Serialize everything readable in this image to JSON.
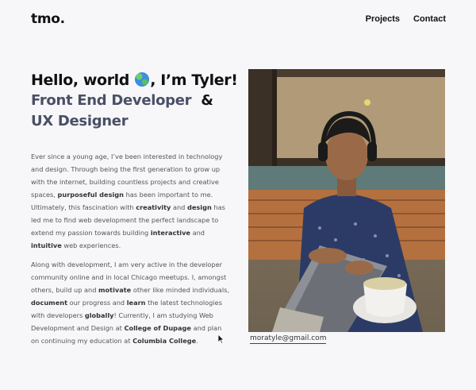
{
  "header": {
    "logo": "tmo.",
    "nav": [
      "Projects",
      "Contact"
    ]
  },
  "hero": {
    "greeting_before": "Hello, world",
    "greeting_after": ", I’m Tyler!",
    "role_line1": "Front End Developer",
    "role_amp": "&",
    "role_line2": "UX Designer"
  },
  "about": {
    "p1": [
      {
        "t": "Ever since a young age, I’ve been interested in technology and design. Through being the first generation to grow up with the internet, building countless projects and creative spaces, "
      },
      {
        "t": "purposeful design",
        "b": true
      },
      {
        "t": " has been important to me. Ultimately, this fascination with "
      },
      {
        "t": "creativity",
        "b": true
      },
      {
        "t": " and "
      },
      {
        "t": "design",
        "b": true
      },
      {
        "t": " has led me to find web development the perfect landscape to extend my passion towards building "
      },
      {
        "t": "interactive",
        "b": true
      },
      {
        "t": " and "
      },
      {
        "t": "intuitive",
        "b": true
      },
      {
        "t": " web experiences."
      }
    ],
    "p2": [
      {
        "t": "Along with development, I am very active in the developer community online and in local Chicago meetups. I, amongst others, build up and "
      },
      {
        "t": "motivate",
        "b": true
      },
      {
        "t": " other like minded individuals, "
      },
      {
        "t": "document",
        "b": true
      },
      {
        "t": " our progress and "
      },
      {
        "t": "learn",
        "b": true
      },
      {
        "t": " the latest technologies with developers "
      },
      {
        "t": "globally",
        "b": true
      },
      {
        "t": "! Currently, I am studying Web Development and Design at "
      },
      {
        "t": "College of Dupage",
        "b": true
      },
      {
        "t": " and plan on continuing my education at "
      },
      {
        "t": "Columbia College",
        "b": true
      },
      {
        "t": "."
      }
    ]
  },
  "photo": {
    "icon": "portrait-photo"
  },
  "contact": {
    "email": "moratyle@gmail.com"
  }
}
